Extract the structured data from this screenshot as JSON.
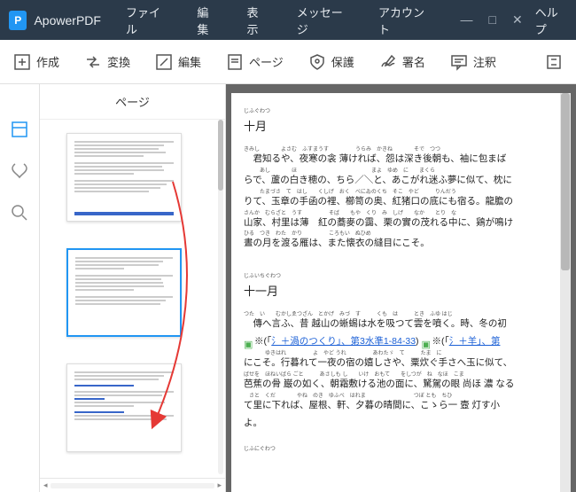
{
  "app": {
    "name": "ApowerPDF",
    "logo_letter": "P"
  },
  "menu": [
    "ファイル",
    "編集",
    "表示",
    "メッセージ",
    "アカウント",
    "ヘルプ"
  ],
  "toolbar": {
    "create": "作成",
    "convert": "変換",
    "edit": "編集",
    "page": "ページ",
    "protect": "保護",
    "sign": "署名",
    "annotate": "注釈"
  },
  "sidebar": {
    "header": "ページ"
  },
  "doc": {
    "h1_ruby": "じふぐわつ",
    "h1": "十月",
    "p1_ruby": "きみし　　　　よさむ　ふすまうす　　　　　うらみ　かきね　　　　そで　つつ",
    "p1a": "　君知るや、夜寒の衾 薄ければ、怨は深き後朝も、袖に包まば",
    "p1_ruby2": "　　　あし　　　　ほ　　　　　　　　　　　　　　まよ　ゆめ　に　　まくら",
    "p1b": "らで、蘆の白き穂の、ちら／＼と、あこがれ迷ふ夢に似て、枕に",
    "p1_ruby3": "　　　たまづさ　て　はし　　くしげ　おく　べにゐのくち　そこ　やど　　　りんだう",
    "p1c": "りて、玉章の手函の裡、櫛笥の奥、紅猪口の底にも宿る。龍膽の",
    "p1_ruby4": "さんか　むらざと　うす　　　　　そば　　もや　くり　み　しげ　　なか　　とり　な",
    "p1d": "山家、村里は薄　紅の蕎麥の靄、栗の實の茂れる中に、鶏が鳴け",
    "p1_ruby5": "ひる　つき　わた　かり　　　　　ころもい　ぬひめ",
    "p1e": "晝の月を渡る雁は、また懐衣の縫目にこそ。",
    "h2_ruby": "じふいちぐわつ",
    "h2": "十一月",
    "p2_ruby": "つた　い　　むかしゑつざん　とかげ　みづ　す　　　くも　は　　　とき　ふゆ はじ",
    "p2a": "　傳へ言ふ、昔 越山の蜥蜴は水を吸つて雲を噴く。時、冬の初",
    "p2b_prefix": "※(「",
    "p2b_u1": "氵＋渦のつくり」、第3水準1-84-33",
    "p2b_mid": "※(「",
    "p2b_u2": "氵＋羊」、第",
    "p2_ruby3": "　　　　ゆきはれ　　　　　よ　やど うれ　　　　　あわたゞ　て　　　たま　に",
    "p2c": "にこそ。行暮れて一夜の宿の嬉しさや、粟炊ぐ手さへ玉に似て、",
    "p2_ruby4": "ばせを　ほねいばら ごと　　　あさしも し　　いけ　おもて　　をしつが　ね　なほ　こま",
    "p2d": "芭蕉の骨 巌の如く、朝霜敷ける池の面に、駑駕の眼 尚ほ 濃 なる",
    "p2_ruby5": "　さと　くだ　　　　やね　のき　ゆふべ　はれま　　　　　　　　　つぼ とも　ちひ",
    "p2e": "て里に下れば、屋根、軒、夕暮の晴間に、こゝら一 壼 灯す小",
    "p2f": "よ。",
    "h3_ruby": "じふにぐわつ"
  }
}
